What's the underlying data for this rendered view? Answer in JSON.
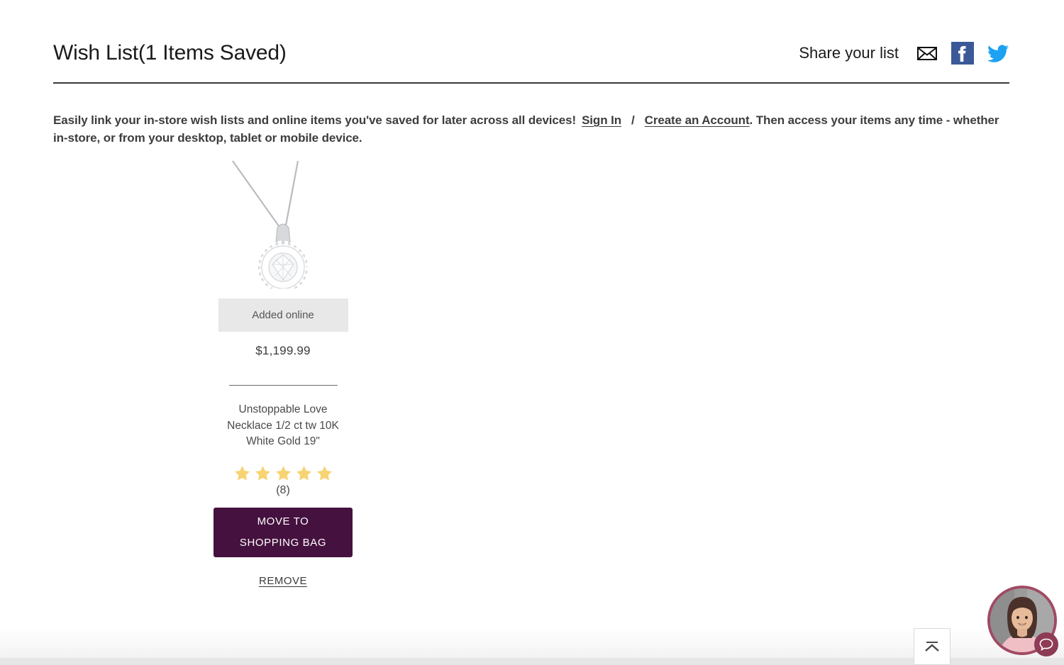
{
  "header": {
    "title": "Wish List(1 Items Saved)",
    "share_label": "Share your list",
    "share_icons": [
      {
        "name": "email-icon",
        "label": "Share by email"
      },
      {
        "name": "facebook-icon",
        "label": "Share on Facebook",
        "color": "#3b5998"
      },
      {
        "name": "twitter-icon",
        "label": "Share on Twitter",
        "color": "#1da1f2"
      }
    ]
  },
  "intro": {
    "text_before": "Easily link your in-store wish lists and online items you've saved for later across all devices!",
    "sign_in_label": "Sign In",
    "separator": "/",
    "create_account_label": "Create an Account",
    "text_after": ". Then access your items any time - whether in-store, or from your desktop, tablet or mobile device."
  },
  "product": {
    "image_alt": "Unstoppable Love diamond halo pendant necklace",
    "badge": "Added online",
    "price": "$1,199.99",
    "name": "Unstoppable Love Necklace 1/2 ct tw 10K White Gold 19\"",
    "rating_stars": 5,
    "rating_star_color": "#f7d372",
    "review_count": "(8)",
    "move_button_line1": "MOVE TO",
    "move_button_line2": "SHOPPING BAG",
    "move_button_color": "#45113f",
    "remove_label": "REMOVE"
  },
  "widgets": {
    "back_to_top_name": "back-to-top-button",
    "chat_name": "chat-agent-button"
  }
}
